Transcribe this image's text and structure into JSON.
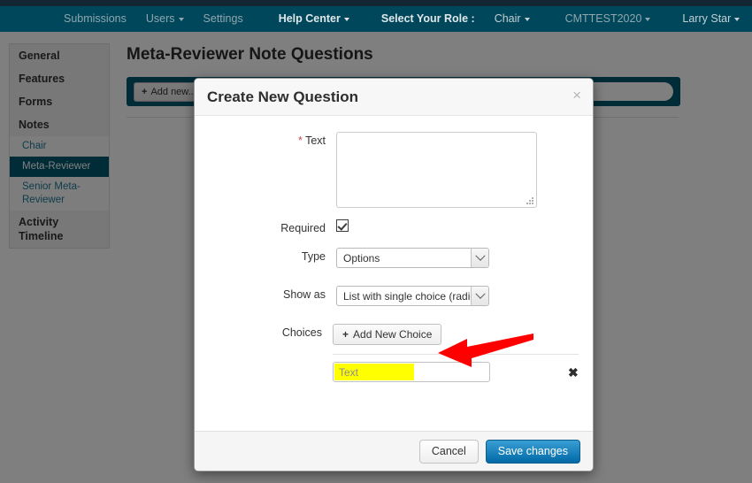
{
  "navbar": {
    "items": [
      {
        "label": "Submissions",
        "caret": false,
        "style": "dim"
      },
      {
        "label": "Users",
        "caret": true,
        "style": "dim"
      },
      {
        "label": "Settings",
        "caret": false,
        "style": "dim"
      },
      {
        "label": "Help Center",
        "caret": true,
        "style": "bright"
      },
      {
        "label": "Select Your Role :",
        "caret": false,
        "style": "bright"
      },
      {
        "label": "Chair",
        "caret": true,
        "style": "semi"
      },
      {
        "label": "CMTTEST2020",
        "caret": true,
        "style": "dim"
      },
      {
        "label": "Larry Star",
        "caret": true,
        "style": "semi"
      }
    ]
  },
  "sidebar": {
    "items": [
      {
        "label": "General"
      },
      {
        "label": "Features"
      },
      {
        "label": "Forms"
      },
      {
        "label": "Notes"
      }
    ],
    "sub_items": [
      {
        "label": "Chair",
        "active": false
      },
      {
        "label": "Meta-Reviewer",
        "active": true
      },
      {
        "label": "Senior Meta-Reviewer",
        "active": false
      }
    ],
    "footer_item": {
      "label": "Activity Timeline"
    }
  },
  "content": {
    "page_title": "Meta-Reviewer Note Questions",
    "toolbar": {
      "add_new_label": "Add new...",
      "plus_glyph": "+"
    }
  },
  "modal": {
    "title": "Create New Question",
    "close_glyph": "×",
    "fields": {
      "text": {
        "label": "Text",
        "required_marker": "*",
        "value": ""
      },
      "required": {
        "label": "Required",
        "checked": true
      },
      "type": {
        "label": "Type",
        "value": "Options"
      },
      "show_as": {
        "label": "Show as",
        "value": "List with single choice (radio button)"
      },
      "choices": {
        "label": "Choices",
        "add_button_label": "Add New Choice",
        "plus_glyph": "+",
        "rows": [
          {
            "placeholder": "Text",
            "value": "",
            "delete_glyph": "✖"
          }
        ]
      }
    },
    "footer": {
      "cancel_label": "Cancel",
      "save_label": "Save changes"
    }
  },
  "annotation": {
    "arrow_color": "#ff0000",
    "points_to": "add-new-choice-button"
  },
  "colors": {
    "navbar": "#01475b",
    "top_strip": "#132633",
    "toolbar_teal": "#01596e",
    "accent_blue": "#0069a6",
    "highlight_yellow": "#ffff00",
    "required_star": "#c0504d"
  }
}
